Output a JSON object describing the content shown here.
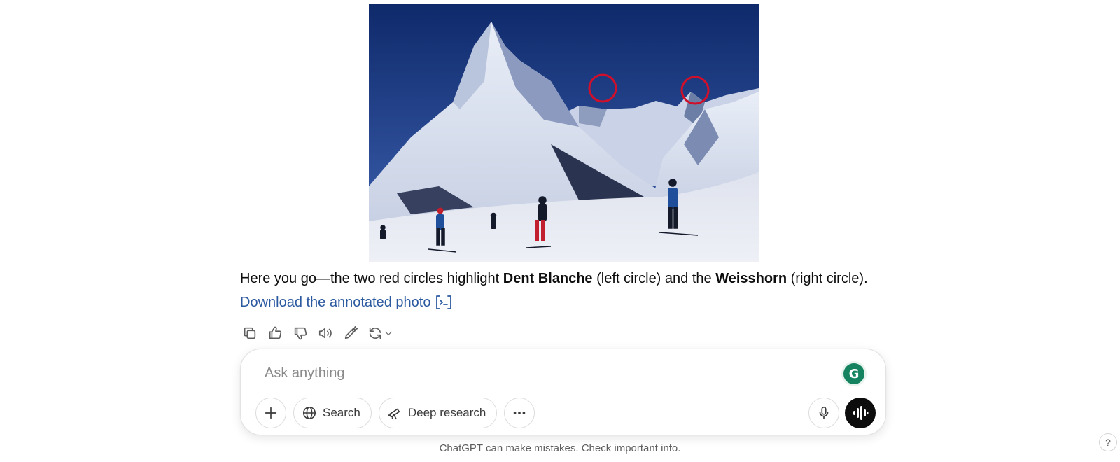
{
  "message": {
    "image_alt": "Matterhorn with skiers, two red circles highlighting peaks",
    "circle_color": "#d0102b",
    "text_prefix": "Here you go—the two red circles highlight ",
    "peak_left": "Dent Blanche",
    "text_mid": " (left circle) and the ",
    "peak_right": "Weisshorn",
    "text_suffix": " (right circle).",
    "download_label": "Download the annotated photo"
  },
  "actions": {
    "icons": [
      "copy-icon",
      "thumbs-up-icon",
      "thumbs-down-icon",
      "read-aloud-icon",
      "edit-icon",
      "regenerate-icon",
      "chevron-down-icon"
    ]
  },
  "composer": {
    "placeholder": "Ask anything",
    "search_label": "Search",
    "deep_research_label": "Deep research",
    "grammarly_letter": "G"
  },
  "footer": {
    "disclaimer": "ChatGPT can make mistakes. Check important info.",
    "help_label": "?"
  },
  "colors": {
    "link": "#2c5aa0",
    "text": "#0d0d0d",
    "voice_button": "#0d0d0d",
    "grammarly": "#15835f"
  }
}
